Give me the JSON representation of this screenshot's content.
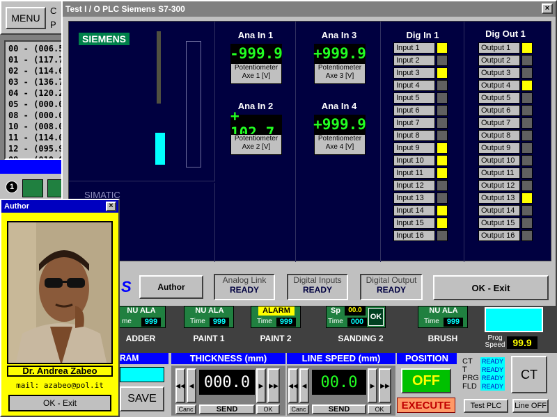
{
  "main": {
    "menu_label": "MENU",
    "menu_side": [
      "C",
      "P"
    ],
    "list_items": [
      "00 - (006.5)",
      "01 - (117.7)",
      "02 - (114.0)",
      "03 - (136.7)",
      "04 - (120.2)",
      "05 - (000.0)",
      "08 - (000.0)",
      "10 - (008.0)",
      "11 - (114.0)",
      "12 - (095.9)",
      "09 - (010.0"
    ],
    "badge_1": "1"
  },
  "author": {
    "title": "Author",
    "name": "Dr. Andrea Zabeo",
    "mail": "mail: azabeo@pol.it",
    "exit_label": "OK - Exit"
  },
  "plc": {
    "title": "Test I / O PLC Siemens S7-300",
    "siemens": "SIEMENS",
    "simatic": "SIMATIC",
    "logo_fragment": "S",
    "analog": [
      {
        "title": "Ana In 1",
        "value": "-999.9",
        "caption1": "Potentiometer",
        "caption2": "Axe 1 [V]"
      },
      {
        "title": "Ana In 2",
        "value": "+ 102.7",
        "caption1": "Potentiometer",
        "caption2": "Axe 2 [V]"
      },
      {
        "title": "Ana In 3",
        "value": "+999.9",
        "caption1": "Potentiometer",
        "caption2": "Axe 3 [V]"
      },
      {
        "title": "Ana In 4",
        "value": "+999.9",
        "caption1": "Potentiometer",
        "caption2": "Axe 4 [V]"
      }
    ],
    "dig_in_title": "Dig In 1",
    "dig_out_title": "Dig Out 1",
    "inputs": [
      "Input 1",
      "Input 2",
      "Input 3",
      "Input 4",
      "Input 5",
      "Input 6",
      "Input 7",
      "Input 8",
      "Input 9",
      "Input 10",
      "Input 11",
      "Input 12",
      "Input 13",
      "Input 14",
      "Input 15",
      "Input 16"
    ],
    "inputs_on": [
      true,
      false,
      true,
      false,
      false,
      false,
      false,
      false,
      true,
      true,
      true,
      false,
      false,
      true,
      true,
      false
    ],
    "outputs": [
      "Output 1",
      "Output 2",
      "Output 3",
      "Output 4",
      "Output 5",
      "Output 6",
      "Output 7",
      "Output 8",
      "Output 9",
      "Output 10",
      "Output 11",
      "Output 12",
      "Output 13",
      "Output 14",
      "Output 15",
      "Output 16"
    ],
    "outputs_on": [
      true,
      false,
      false,
      true,
      false,
      false,
      false,
      false,
      false,
      false,
      false,
      false,
      true,
      false,
      false,
      false
    ],
    "author_btn": "Author",
    "analog_link": {
      "label": "Analog Link",
      "status": "READY"
    },
    "digital_inputs": {
      "label": "Digital Inputs",
      "status": "READY"
    },
    "digital_output": {
      "label": "Digital Output",
      "status": "READY"
    },
    "ok_exit": "OK - Exit"
  },
  "stations": [
    {
      "status": "NU ALA",
      "time_label": "me",
      "time": "999",
      "name": "ADDER"
    },
    {
      "status": "NU ALA",
      "time_label": "Time",
      "time": "999",
      "name": "PAINT 1"
    },
    {
      "status": "ALARM",
      "time_label": "Time",
      "time": "999",
      "name": "PAINT 2"
    },
    {
      "status": "Sp",
      "sp_value": "00.0",
      "time_label": "Time",
      "time": "000",
      "name": "SANDING 2",
      "ok": "OK"
    },
    {
      "status": "NU ALA",
      "time_label": "Time",
      "time": "999",
      "name": "BRUSH"
    }
  ],
  "prog_speed": {
    "label1": "Prog",
    "label2": "Speed",
    "value": "99.9"
  },
  "bottom": {
    "program_label": "RAM",
    "save_label": "SAVE",
    "thickness": {
      "title": "THICKNESS  (mm)",
      "value": "000.0",
      "canc": "Canc",
      "send": "SEND",
      "ok": "OK"
    },
    "line_speed": {
      "title": "LINE SPEED  (mm)",
      "value": "00.0",
      "canc": "Canc",
      "send": "SEND",
      "ok": "OK"
    },
    "position": {
      "title": "POSITION",
      "off": "OFF",
      "execute": "EXECUTE"
    },
    "status": {
      "ct": "CT",
      "t": "T",
      "prg": "PRG",
      "fld": "FLD",
      "ready": "READY"
    },
    "ct_btn": "CT",
    "test_plc": "Test PLC",
    "line_off": "Line OFF"
  }
}
